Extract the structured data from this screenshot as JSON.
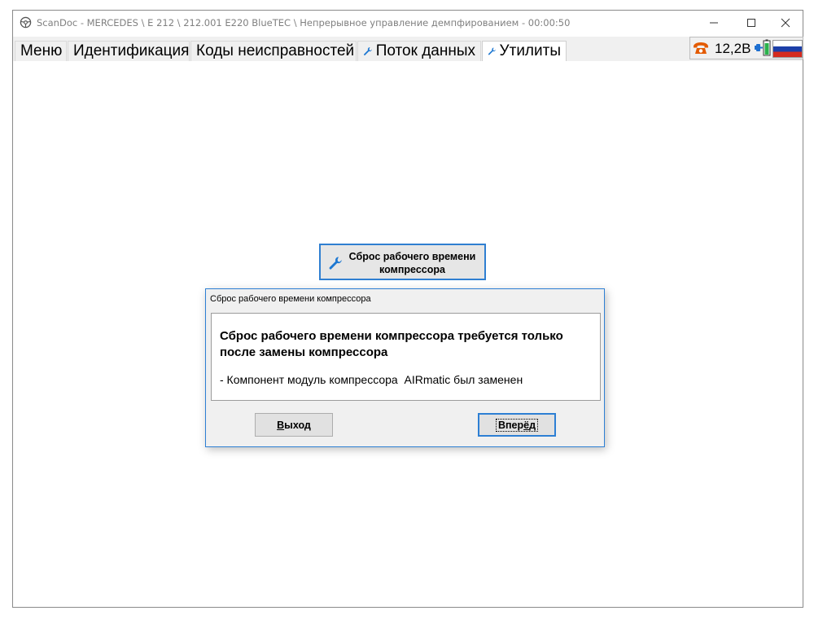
{
  "window": {
    "title": "ScanDoc - MERCEDES \\ E 212 \\ 212.001 E220 BlueTEC \\ Непрерывное управление демпфированием - 00:00:50",
    "controls": {
      "minimize": "minimize-icon",
      "maximize": "maximize-icon",
      "close": "close-icon"
    }
  },
  "tabs": [
    {
      "label": "Меню",
      "icon": null
    },
    {
      "label": "Идентификация",
      "icon": null
    },
    {
      "label": "Коды неисправностей",
      "icon": null
    },
    {
      "label": "Поток данных",
      "icon": "wrench-icon"
    },
    {
      "label": "Утилиты",
      "icon": "wrench-icon",
      "active": true
    }
  ],
  "status": {
    "voltage": "12,2В",
    "icons": [
      "phone-icon",
      "plug-battery-icon",
      "russian-flag-icon"
    ]
  },
  "main": {
    "utility_button": {
      "label_line1": "Сброс рабочего времени",
      "label_line2": "компрессора"
    }
  },
  "dialog": {
    "title": "Сброс рабочего времени компрессора",
    "headline": "Сброс рабочего времени компрессора требуется только после замены компрессора",
    "detail": "- Компонент модуль компрессора  AIRmatic был заменен",
    "buttons": {
      "exit": {
        "before": "",
        "mnemonic": "В",
        "after": "ыход"
      },
      "next": {
        "before": "Впер",
        "mnemonic": "ё",
        "after": "д"
      }
    }
  },
  "colors": {
    "accent": "#2d7fd4",
    "wrench": "#1e78d2",
    "phone": "#e35a00"
  }
}
